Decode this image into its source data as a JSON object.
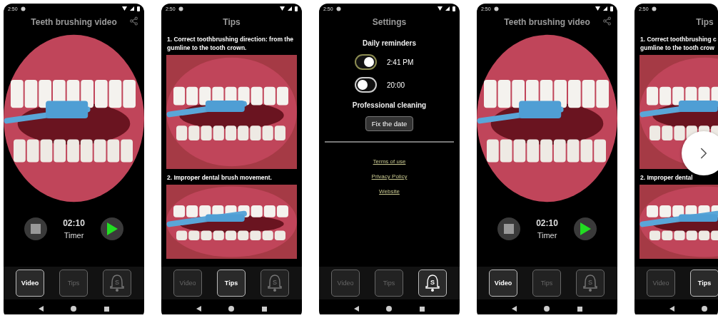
{
  "screens": [
    {
      "kind": "video",
      "status_time": "2:50",
      "title": "Teeth brushing video",
      "timer": "02:10",
      "timer_label": "Timer",
      "tabs": [
        {
          "kind": "text",
          "label": "Video",
          "selected": true
        },
        {
          "kind": "text",
          "label": "Tips",
          "selected": false
        },
        {
          "kind": "bell",
          "label": "S",
          "selected": false
        }
      ]
    },
    {
      "kind": "tips",
      "status_time": "2:50",
      "title": "Tips",
      "tips": [
        {
          "lines": [
            "1. Correct toothbrushing direction: from the",
            "gumline to the tooth crown."
          ]
        },
        {
          "lines": [
            "2. Improper dental brush movement."
          ]
        }
      ],
      "tabs": [
        {
          "kind": "text",
          "label": "Video",
          "selected": false
        },
        {
          "kind": "text",
          "label": "Tips",
          "selected": true
        },
        {
          "kind": "bell",
          "label": "S",
          "selected": false
        }
      ]
    },
    {
      "kind": "settings",
      "status_time": "2:50",
      "title": "Settings",
      "section": "Daily reminders",
      "reminders": [
        {
          "time": "2:41 PM",
          "on": true
        },
        {
          "time": "20:00",
          "on": false
        }
      ],
      "cleaning_label": "Professional cleaning",
      "cleaning_button": "Fix the date",
      "links": [
        "Terms of use",
        "Privacy Policy",
        "Website"
      ],
      "tabs": [
        {
          "kind": "text",
          "label": "Video",
          "selected": false
        },
        {
          "kind": "text",
          "label": "Tips",
          "selected": false
        },
        {
          "kind": "bell",
          "label": "S",
          "selected": true
        }
      ]
    },
    {
      "kind": "video",
      "status_time": "2:50",
      "title": "Teeth brushing video",
      "timer": "02:10",
      "timer_label": "Timer",
      "tabs": [
        {
          "kind": "text",
          "label": "Video",
          "selected": true
        },
        {
          "kind": "text",
          "label": "Tips",
          "selected": false
        },
        {
          "kind": "bell",
          "label": "S",
          "selected": false
        }
      ]
    },
    {
      "kind": "tips",
      "status_time": "2:50",
      "title": "Tips",
      "tips": [
        {
          "lines": [
            "1. Correct toothbrushing c",
            "gumline to the tooth crow"
          ]
        },
        {
          "lines": [
            "2. Improper dental"
          ]
        }
      ],
      "tabs": [
        {
          "kind": "text",
          "label": "Video",
          "selected": false
        },
        {
          "kind": "text",
          "label": "Tips",
          "selected": true
        }
      ]
    }
  ]
}
